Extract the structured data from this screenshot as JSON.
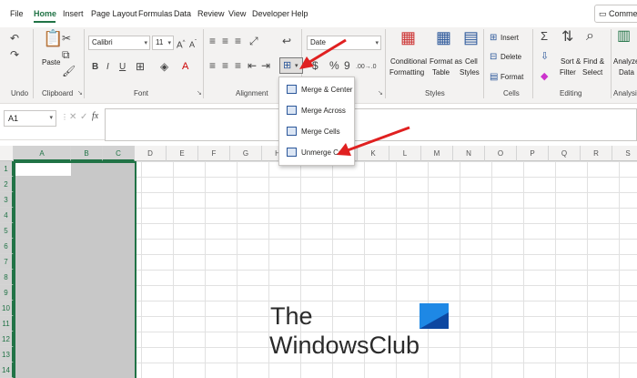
{
  "menu_tabs": [
    "File",
    "Home",
    "Insert",
    "Page Layout",
    "Formulas",
    "Data",
    "Review",
    "View",
    "Developer",
    "Help"
  ],
  "comments_label": "Comment",
  "ribbon": {
    "undo_label": "Undo",
    "clipboard": {
      "label": "Clipboard",
      "paste_label": "Paste"
    },
    "font": {
      "label": "Font",
      "font_name": "Calibri",
      "font_size": "11",
      "bold": "B",
      "italic": "I",
      "underline": "U",
      "grow": "A^",
      "shrink": "Aˇ"
    },
    "alignment": {
      "label": "Alignment"
    },
    "number": {
      "format": "Date",
      "currency": "$",
      "percent": "%",
      "comma": "9",
      "inc_decimal": ".00→.0",
      "dec_decimal": ".00→.0"
    },
    "styles": {
      "label": "Styles",
      "conditional": [
        "Conditional",
        "Formatting"
      ],
      "format_table": [
        "Format as",
        "Table"
      ],
      "cell_styles": [
        "Cell",
        "Styles"
      ]
    },
    "cells": {
      "label": "Cells",
      "insert": "Insert",
      "delete": "Delete",
      "format": "Format"
    },
    "editing": {
      "label": "Editing",
      "sort": [
        "Sort &",
        "Filter"
      ],
      "find": [
        "Find &",
        "Select"
      ]
    },
    "analysis": {
      "label": "Analysis",
      "analyze": [
        "Analyze",
        "Data"
      ]
    }
  },
  "formula_bar": {
    "name_box": "A1",
    "cancel": "✕",
    "enter": "✓",
    "fx": "fx",
    "value": ""
  },
  "columns": [
    "A",
    "B",
    "C",
    "D",
    "E",
    "F",
    "G",
    "H",
    "I",
    "J",
    "K",
    "L",
    "M",
    "N",
    "O",
    "P",
    "Q",
    "R",
    "S"
  ],
  "rows": [
    "1",
    "2",
    "3",
    "4",
    "5",
    "6",
    "7",
    "8",
    "9",
    "10",
    "11",
    "12",
    "13",
    "14"
  ],
  "merge_menu": [
    "Merge & Center",
    "Merge Across",
    "Merge Cells",
    "Unmerge Cells"
  ],
  "watermark": {
    "line1": "The",
    "line2": "WindowsClub"
  },
  "colors": {
    "accent": "#217346",
    "arrow": "#e02020",
    "selection": "#c8c8c8"
  }
}
